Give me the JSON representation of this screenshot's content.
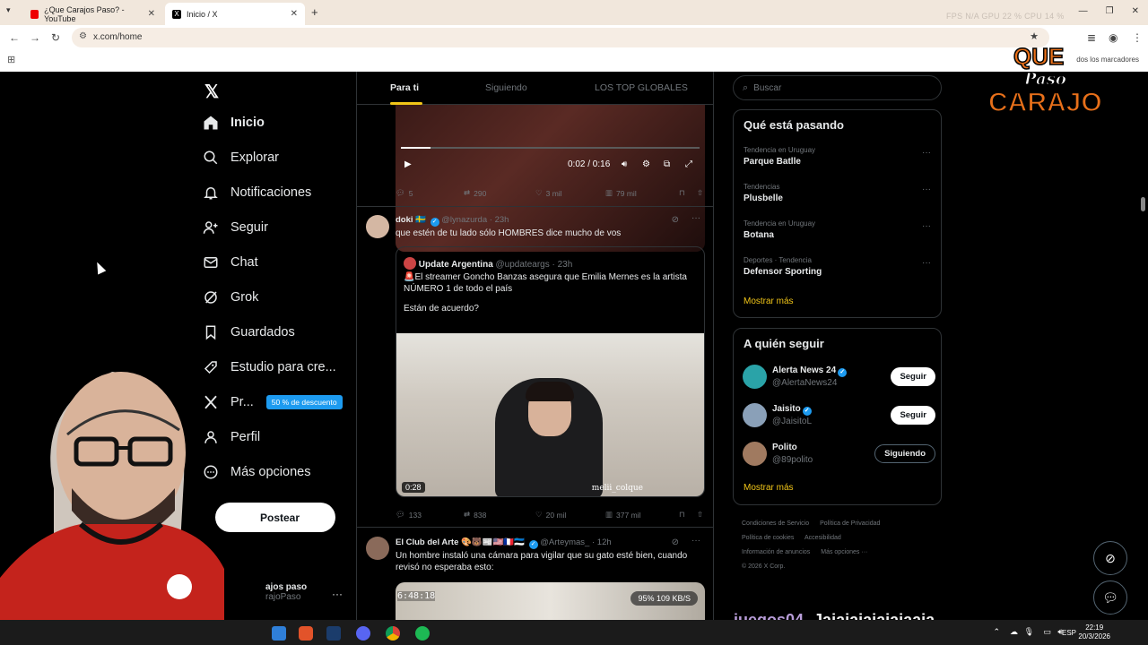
{
  "browser": {
    "tabs": [
      {
        "title": "¿Que Carajos Paso? - YouTube"
      },
      {
        "title": "Inicio / X"
      }
    ],
    "url": "x.com/home",
    "bookmarks_label": "dos los marcadores",
    "sys_stats": "FPS N/A   GPU 22 %   CPU 14 %"
  },
  "nav": {
    "items": [
      {
        "label": "Inicio"
      },
      {
        "label": "Explorar"
      },
      {
        "label": "Notificaciones"
      },
      {
        "label": "Seguir"
      },
      {
        "label": "Chat"
      },
      {
        "label": "Grok"
      },
      {
        "label": "Guardados"
      },
      {
        "label": "Estudio para cre..."
      },
      {
        "label": "Pr..."
      },
      {
        "label": "Perfil"
      },
      {
        "label": "Más opciones"
      }
    ],
    "promo_badge": "50 % de descuento",
    "post_button": "Postear",
    "account_name": "ajos paso",
    "account_handle": "rajoPaso"
  },
  "timeline": {
    "tabs": [
      "Para ti",
      "Siguiendo",
      "LOS TOP GLOBALES"
    ],
    "tweet1": {
      "video_time": "0:02 / 0:16",
      "progress_fraction": 0.1,
      "replies": "5",
      "reposts": "290",
      "likes": "3 mil",
      "views": "79 mil"
    },
    "tweet2": {
      "name": "doki 🇸🇪",
      "handle": "@lynazurda",
      "time": "· 23h",
      "text": "que estén de tu lado sólo HOMBRES dice mucho de vos",
      "quote": {
        "name": "Update Argentina",
        "handle": "@updateargs",
        "time": "· 23h",
        "text": "🚨El streamer Goncho Banzas asegura que Emilia Mernes es la artista NÚMERO 1 de todo el país",
        "text2": "Están de acuerdo?",
        "video_duration": "0:28",
        "watermark": "melii_colque"
      },
      "replies": "133",
      "reposts": "838",
      "likes": "20 mil",
      "views": "377 mil"
    },
    "tweet3": {
      "name": "El Club del Arte 🎨🐻📰🇺🇸🇫🇷🇪🇪",
      "handle": "@Arteymas_",
      "time": "· 12h",
      "text": "Un hombre instaló una cámara para vigilar que su gato esté bien, cuando revisó no esperaba esto:",
      "video_timestamp": "6:48:18",
      "video_stats": "95%   109 KB/S"
    }
  },
  "sidebar": {
    "search_placeholder": "Buscar",
    "trends_title": "Qué está pasando",
    "trends": [
      {
        "meta": "Tendencia en Uruguay",
        "name": "Parque Batlle"
      },
      {
        "meta": "Tendencias",
        "name": "Plusbelle"
      },
      {
        "meta": "Tendencia en Uruguay",
        "name": "Botana"
      },
      {
        "meta": "Deportes · Tendencia",
        "name": "Defensor Sporting"
      }
    ],
    "show_more": "Mostrar más",
    "follow_title": "A quién seguir",
    "follow": [
      {
        "name": "Alerta News 24",
        "handle": "@AlertaNews24",
        "button": "Seguir"
      },
      {
        "name": "Jaisito",
        "handle": "@JaisitoL",
        "button": "Seguir"
      },
      {
        "name": "Polito",
        "handle": "@89polito",
        "button": "Siguiendo"
      }
    ],
    "footer": [
      "Condiciones de Servicio",
      "Política de Privacidad",
      "Política de cookies",
      "Accesibilidad",
      "Información de anuncios",
      "Más opciones ···",
      "© 2026 X Corp."
    ]
  },
  "overlay": {
    "brand_line1": "QUE",
    "brand_line2": "Paso",
    "brand_line3": "CARAJO",
    "chat_user": "juegos04",
    "chat_message": "Jajajajajajajaaja"
  },
  "taskbar": {
    "language": "ESP",
    "time": "22:19",
    "date": "20/3/2026"
  },
  "colors": {
    "accent": "#f2c618",
    "verified": "#1d9bf0",
    "background": "#000000"
  }
}
